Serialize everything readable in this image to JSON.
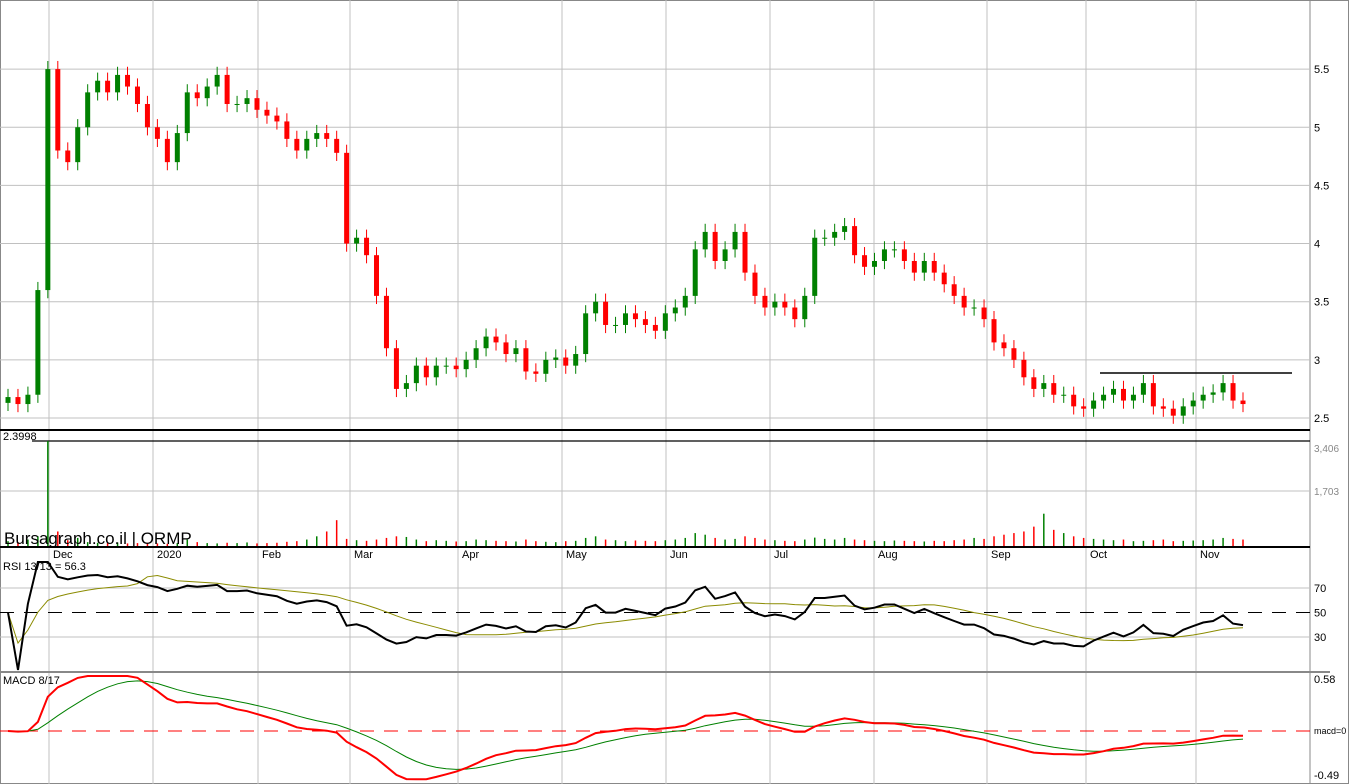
{
  "chart_data": {
    "type": "candlestick",
    "title": "Bursagraph.co.il | ORMP",
    "months": [
      "Dec",
      "2020",
      "Feb",
      "Mar",
      "Apr",
      "May",
      "Jun",
      "Jul",
      "Aug",
      "Sep",
      "Oct",
      "Nov"
    ],
    "price_ticks": [
      "5.5",
      "5",
      "4.5",
      "4",
      "3.5",
      "3",
      "2.5"
    ],
    "price_tick_values": [
      5.5,
      5,
      4.5,
      4,
      3.5,
      3,
      2.5
    ],
    "support_level": 2.3998,
    "support_label": "2.3998",
    "resistance_level": 2.89,
    "volume_ticks": [
      "3,406",
      "1,703"
    ],
    "rsi": {
      "label": "RSI 13/13 = 56.3",
      "ticks": [
        "70",
        "50",
        "30"
      ],
      "period": 13,
      "signal": 13
    },
    "macd": {
      "label": "MACD 8/17",
      "ticks": [
        "0.58",
        "macd=0",
        "-0.49"
      ],
      "fast": 8,
      "slow": 17,
      "signal": 9
    },
    "colors": {
      "up": "#008000",
      "down": "#ff0000",
      "grid": "#c0c0c0",
      "rsi": "#000000",
      "rsi_signal": "#8b8b00",
      "macd": "#ff0000",
      "macd_signal": "#008000"
    },
    "closes": [
      2.68,
      2.62,
      2.7,
      3.6,
      5.5,
      4.8,
      4.7,
      5.0,
      5.3,
      5.4,
      5.3,
      5.45,
      5.35,
      5.2,
      5.0,
      4.9,
      4.7,
      4.95,
      5.3,
      5.25,
      5.35,
      5.45,
      5.2,
      5.2,
      5.25,
      5.15,
      5.1,
      5.05,
      4.9,
      4.8,
      4.9,
      4.95,
      4.9,
      4.78,
      4.0,
      4.05,
      3.9,
      3.55,
      3.1,
      2.75,
      2.8,
      2.95,
      2.85,
      2.95,
      2.95,
      2.92,
      3.0,
      3.1,
      3.2,
      3.15,
      3.05,
      3.1,
      2.9,
      2.88,
      3.0,
      3.02,
      2.95,
      3.05,
      3.4,
      3.5,
      3.3,
      3.3,
      3.4,
      3.35,
      3.3,
      3.25,
      3.4,
      3.45,
      3.55,
      3.95,
      4.1,
      3.85,
      3.95,
      4.1,
      3.75,
      3.55,
      3.45,
      3.5,
      3.45,
      3.35,
      3.55,
      4.05,
      4.05,
      4.1,
      4.15,
      3.9,
      3.8,
      3.85,
      3.95,
      3.95,
      3.85,
      3.75,
      3.85,
      3.75,
      3.65,
      3.55,
      3.45,
      3.45,
      3.35,
      3.15,
      3.1,
      3.0,
      2.85,
      2.75,
      2.8,
      2.7,
      2.7,
      2.6,
      2.58,
      2.65,
      2.7,
      2.75,
      2.65,
      2.7,
      2.8,
      2.6,
      2.58,
      2.52,
      2.6,
      2.65,
      2.7,
      2.72,
      2.8,
      2.65,
      2.62
    ],
    "volumes": [
      150,
      120,
      200,
      300,
      3600,
      450,
      180,
      250,
      120,
      100,
      90,
      110,
      80,
      90,
      100,
      80,
      70,
      90,
      200,
      120,
      90,
      80,
      100,
      90,
      110,
      80,
      90,
      100,
      130,
      150,
      200,
      300,
      450,
      800,
      220,
      180,
      160,
      200,
      250,
      300,
      280,
      200,
      150,
      180,
      160,
      140,
      150,
      200,
      180,
      160,
      150,
      140,
      200,
      150,
      130,
      120,
      150,
      160,
      250,
      300,
      200,
      180,
      150,
      170,
      160,
      150,
      180,
      200,
      250,
      400,
      350,
      250,
      200,
      220,
      300,
      250,
      200,
      180,
      160,
      150,
      200,
      260,
      220,
      200,
      250,
      200,
      180,
      160,
      150,
      170,
      160,
      150,
      140,
      160,
      150,
      180,
      200,
      250,
      220,
      300,
      350,
      400,
      450,
      600,
      1000,
      500,
      400,
      300,
      250,
      220,
      200,
      180,
      200,
      150,
      160,
      180,
      200,
      150,
      160,
      170,
      180,
      200,
      250,
      220,
      200
    ]
  }
}
